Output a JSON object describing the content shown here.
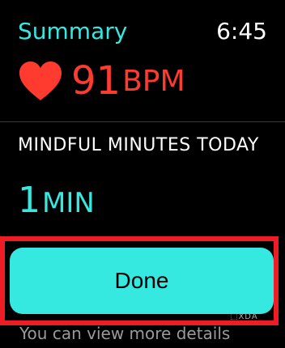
{
  "header": {
    "title": "Summary",
    "time": "6:45"
  },
  "heart_rate": {
    "value": "91",
    "unit": "BPM",
    "icon": "heart-icon",
    "color": "#ff3b2f"
  },
  "mindful": {
    "label": "MINDFUL MINUTES TODAY",
    "value": "1",
    "unit": "MIN"
  },
  "actions": {
    "done_label": "Done"
  },
  "footer": {
    "text": "You can view more details"
  },
  "watermark": "⬚XDA",
  "colors": {
    "accent": "#35e8e0",
    "heart": "#ff3b2f",
    "highlight": "#ee1c25",
    "background": "#000000"
  }
}
